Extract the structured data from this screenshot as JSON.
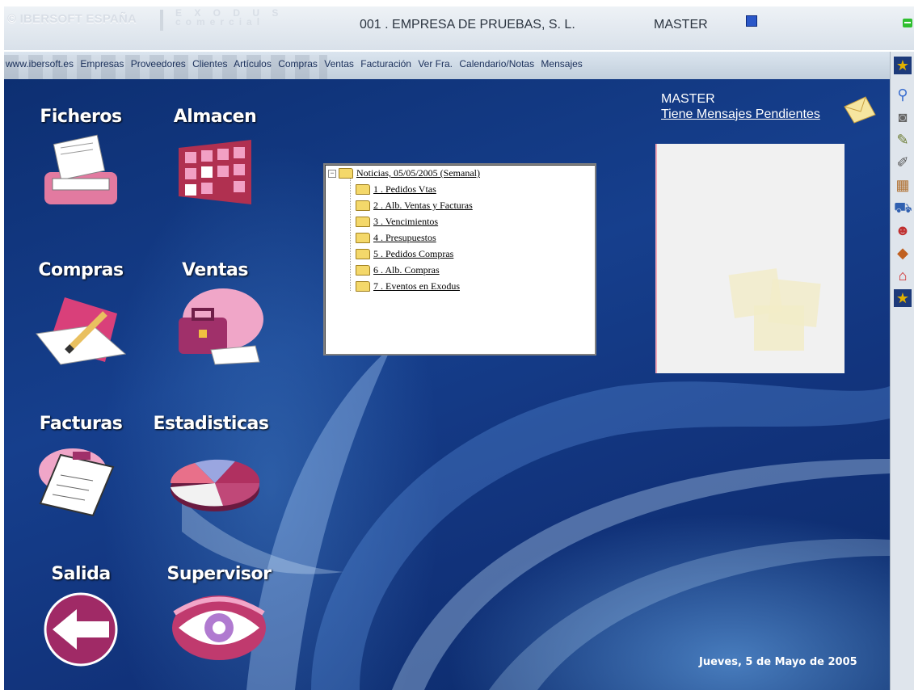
{
  "header": {
    "brand": "© IBERSOFT ESPAÑA",
    "product_line1": "E X O D U S",
    "product_line2": "comercial",
    "company": "001 . EMPRESA DE PRUEBAS, S. L.",
    "user": "MASTER"
  },
  "menu": [
    "www.ibersoft.es",
    "Empresas",
    "Proveedores",
    "Clientes",
    "Artículos",
    "Compras",
    "Ventas",
    "Facturación",
    "Ver Fra.",
    "Calendario/Notas",
    "Mensajes"
  ],
  "modules": {
    "ficheros": "Ficheros",
    "almacen": "Almacen",
    "compras": "Compras",
    "ventas": "Ventas",
    "facturas": "Facturas",
    "estadisticas": "Estadisticas",
    "salida": "Salida",
    "supervisor": "Supervisor"
  },
  "news_tree": {
    "root": "Noticias, 05/05/2005 (Semanal)",
    "items": [
      "1 . Pedidos Vtas",
      "2 . Alb. Ventas y Facturas",
      "3 . Vencimientos",
      "4 . Presupuestos",
      "5 . Pedidos Compras",
      "6 . Alb. Compras",
      "7 . Eventos en Exodus"
    ]
  },
  "messages": {
    "user": "MASTER",
    "pending": "Tiene Mensajes Pendientes"
  },
  "date": "Jueves,  5 de Mayo de 2005",
  "toolbar_icons": [
    "star-icon",
    "search-icon",
    "camera-icon",
    "map-icon",
    "edit-icon",
    "grid-icon",
    "truck-icon",
    "users-icon",
    "box-icon",
    "home-icon",
    "star-icon"
  ],
  "colors": {
    "background": "#163f8d",
    "accent": "#f1a7c0",
    "text_light": "#ffffff"
  }
}
